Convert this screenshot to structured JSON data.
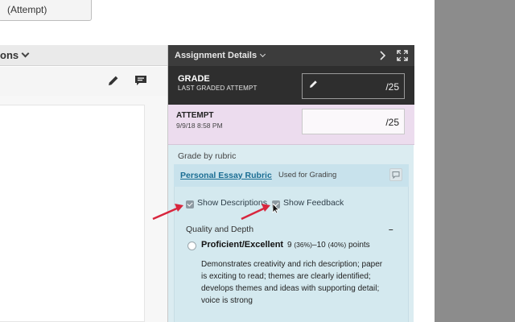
{
  "left": {
    "top_button_label": "(Attempt)",
    "options_label": "ons",
    "pencil_icon": "pencil-icon",
    "comment_icon": "comment-icon"
  },
  "panel": {
    "header_title": "Assignment Details",
    "grade": {
      "title": "GRADE",
      "subtitle": "LAST GRADED ATTEMPT",
      "value": "/25"
    },
    "attempt": {
      "title": "ATTEMPT",
      "date": "9/9/18 8:58 PM",
      "value": "/25"
    },
    "grade_by_rubric": "Grade by rubric",
    "rubric": {
      "name": "Personal Essay Rubric",
      "used_for": "Used for Grading",
      "show_descriptions": "Show Descriptions",
      "show_feedback": "Show Feedback",
      "criterion": "Quality and Depth",
      "collapse": "–",
      "level": {
        "title": "Proficient/Excellent",
        "points_low": "9",
        "pct_low": "(36%)",
        "dash": "–",
        "points_high": "10",
        "pct_high": "(40%)",
        "unit": "points",
        "description": "Demonstrates creativity and rich description; paper is exciting to read; themes are clearly identified; develops themes and ideas with supporting detail; voice is strong"
      }
    }
  },
  "colors": {
    "panel_bg": "#dbecf1",
    "header_bg": "#3c3c3c",
    "attempt_bg": "#ecdcee",
    "link": "#1a6d93",
    "arrow": "#d8263d"
  }
}
